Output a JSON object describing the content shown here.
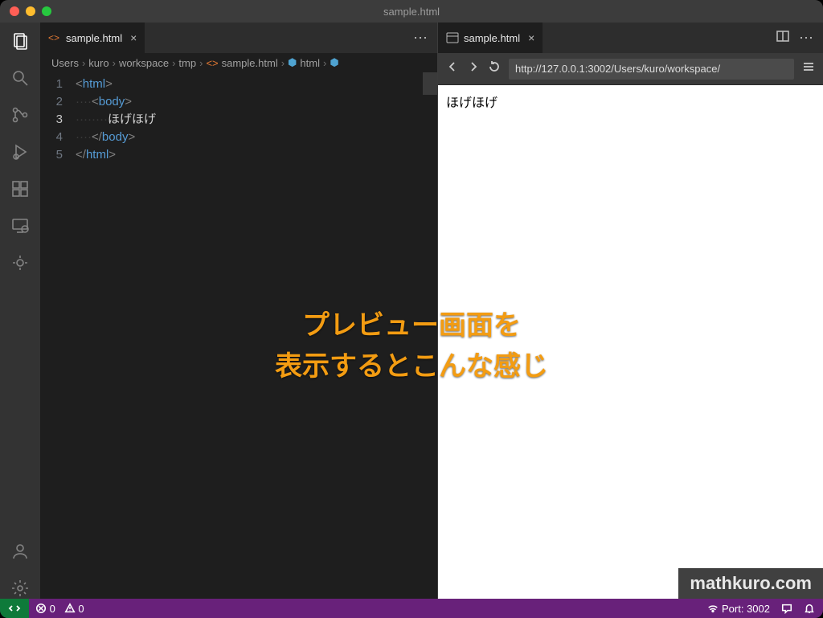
{
  "window": {
    "title": "sample.html"
  },
  "traffic": {
    "close": "close",
    "min": "minimize",
    "max": "maximize"
  },
  "activity": {
    "explorer": "explorer",
    "search": "search",
    "scm": "source-control",
    "debug": "run-debug",
    "extensions": "extensions",
    "remote": "remote-explorer",
    "live": "live-share",
    "account": "accounts",
    "settings": "settings"
  },
  "tabs": {
    "left": {
      "label": "sample.html",
      "close": "×"
    },
    "right": {
      "label": "sample.html",
      "close": "×"
    },
    "more": "⋯"
  },
  "breadcrumbs": {
    "items": [
      "Users",
      "kuro",
      "workspace",
      "tmp",
      "sample.html",
      "html"
    ],
    "sep": "›"
  },
  "code": {
    "line_numbers": [
      "1",
      "2",
      "3",
      "4",
      "5"
    ],
    "lines": [
      {
        "indent": "",
        "open": "<",
        "tag": "html",
        "rest": ">"
      },
      {
        "indent": "····",
        "open": "<",
        "tag": "body",
        "rest": ">"
      },
      {
        "indent": "········",
        "open": "",
        "tag": "",
        "rest": "ほげほげ"
      },
      {
        "indent": "····",
        "open": "</",
        "tag": "body",
        "rest": ">"
      },
      {
        "indent": "",
        "open": "</",
        "tag": "html",
        "rest": ">"
      }
    ]
  },
  "preview": {
    "toolbar": {
      "back": "back",
      "forward": "forward",
      "reload": "reload",
      "menu": "menu"
    },
    "url": "http://127.0.0.1:3002/Users/kuro/workspace/",
    "body": "ほげほげ"
  },
  "status": {
    "errors": "0",
    "warnings": "0",
    "port_label": "Port:",
    "port_value": "3002"
  },
  "overlay": {
    "line1": "プレビュー画面を",
    "line2": "表示するとこんな感じ"
  },
  "watermark": "mathkuro.com"
}
